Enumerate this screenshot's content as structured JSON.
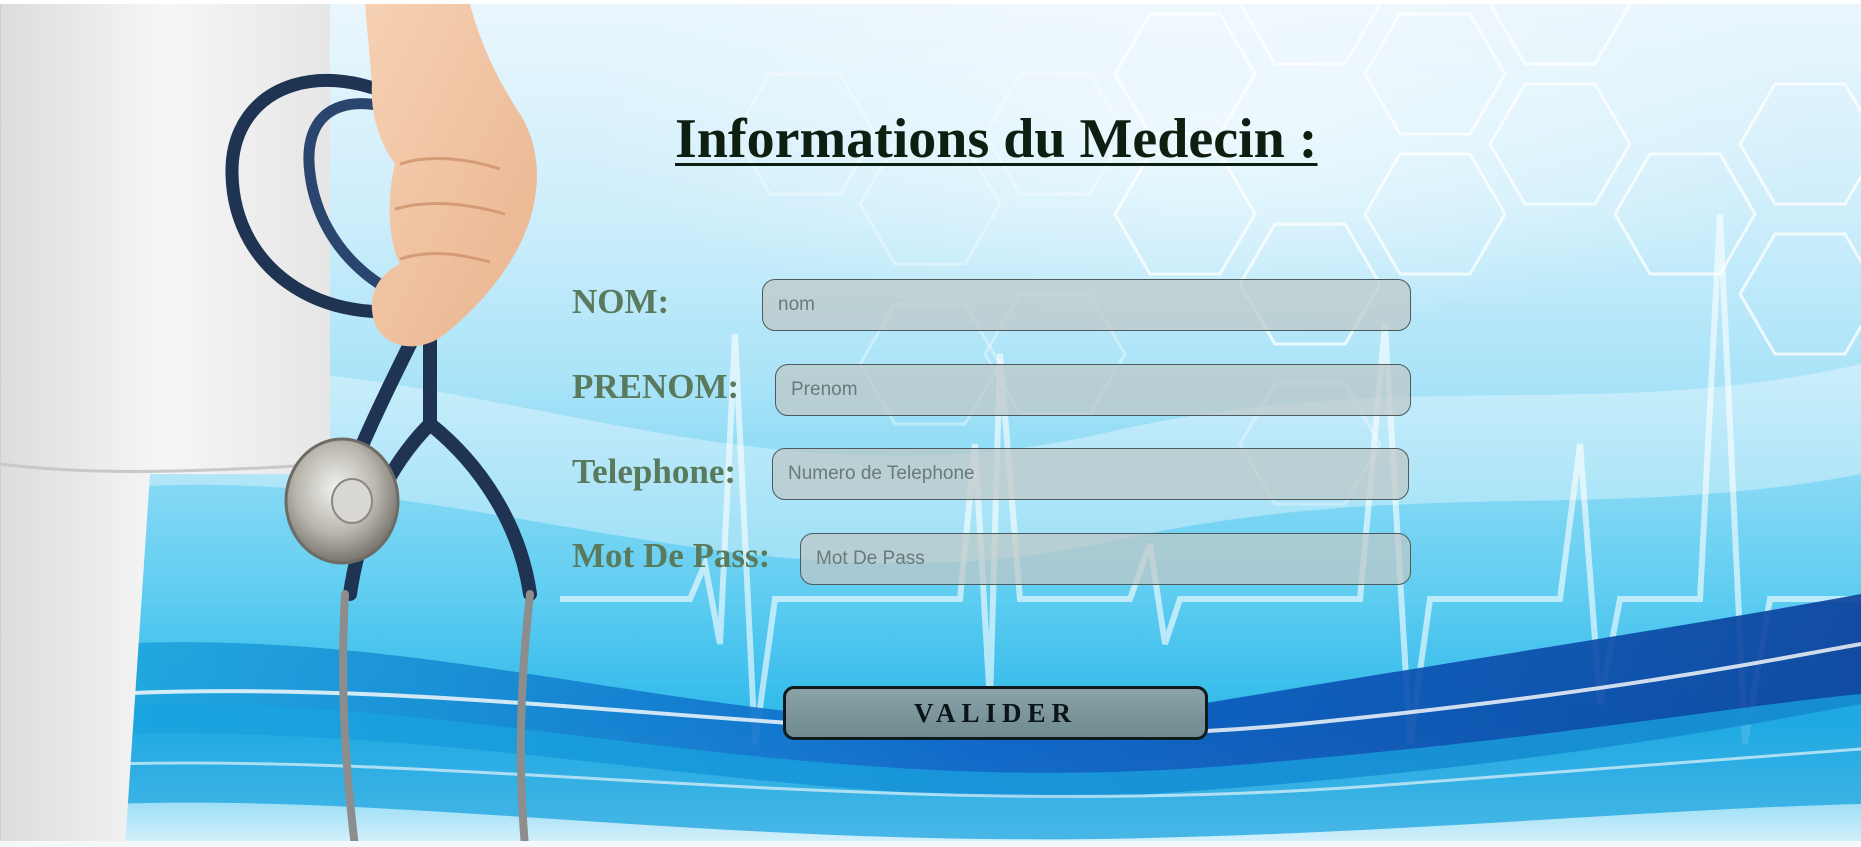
{
  "form": {
    "title": "Informations du Medecin :",
    "fields": [
      {
        "label": "NOM:",
        "placeholder": "nom"
      },
      {
        "label": "PRENOM:",
        "placeholder": "Prenom"
      },
      {
        "label": "Telephone:",
        "placeholder": "Numero de Telephone"
      },
      {
        "label": "Mot De Pass:",
        "placeholder": "Mot De Pass"
      }
    ],
    "submit_label": "VALIDER"
  },
  "background": {
    "illustration": "doctor-holding-stethoscope",
    "pattern": "hexagon-grid-and-heartbeat-line",
    "colors": {
      "sky": "#cdeefb",
      "wave_blue": "#0a5fc4",
      "cyan": "#29b6e8",
      "title_text": "#0d1f10",
      "label_text": "#5a7a5d"
    }
  }
}
